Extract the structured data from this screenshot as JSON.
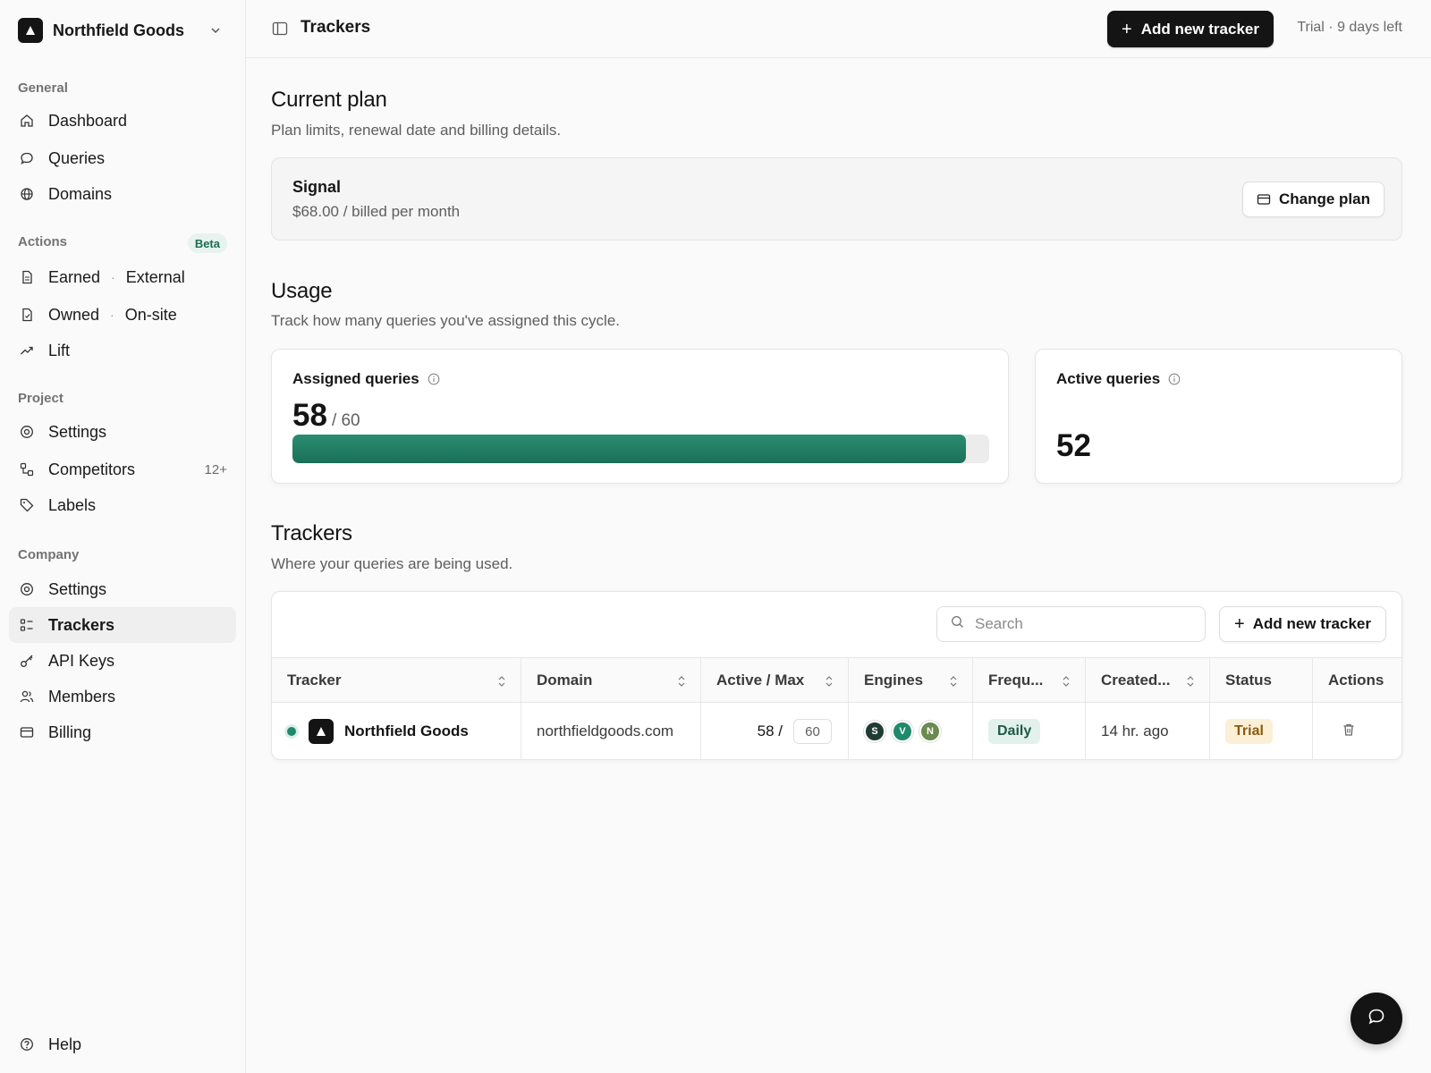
{
  "org": {
    "name": "Northfield Goods"
  },
  "sidebar": {
    "general_title": "General",
    "general": [
      {
        "label": "Dashboard",
        "icon": "home-icon"
      },
      {
        "label": "Queries",
        "icon": "chat-icon"
      },
      {
        "label": "Domains",
        "icon": "globe-icon"
      }
    ],
    "actions_title": "Actions",
    "actions_badge": "Beta",
    "actions": [
      {
        "label": "Earned",
        "suffix": "External",
        "icon": "document-icon"
      },
      {
        "label": "Owned",
        "suffix": "On-site",
        "icon": "document-check-icon"
      },
      {
        "label": "Lift",
        "icon": "trend-up-icon"
      }
    ],
    "project_title": "Project",
    "project": [
      {
        "label": "Settings",
        "icon": "settings-icon"
      },
      {
        "label": "Competitors",
        "count": "12+",
        "icon": "competitors-icon"
      },
      {
        "label": "Labels",
        "icon": "tag-icon"
      }
    ],
    "company_title": "Company",
    "company": [
      {
        "label": "Settings",
        "icon": "settings-icon"
      },
      {
        "label": "Trackers",
        "icon": "list-icon",
        "active": true
      },
      {
        "label": "API Keys",
        "icon": "key-icon"
      },
      {
        "label": "Members",
        "icon": "users-icon"
      },
      {
        "label": "Billing",
        "icon": "card-icon"
      }
    ],
    "help": "Help"
  },
  "topbar": {
    "title": "Trackers",
    "add_button": "Add new tracker",
    "trial": "Trial · 9 days left"
  },
  "plan": {
    "heading": "Current plan",
    "description": "Plan limits, renewal date and billing details.",
    "name": "Signal",
    "price": "$68.00 / billed per month",
    "change_button": "Change plan"
  },
  "usage": {
    "heading": "Usage",
    "description": "Track how many queries you've assigned this cycle.",
    "assigned_title": "Assigned queries",
    "assigned_value": "58",
    "assigned_max": "/ 60",
    "assigned_fraction": 0.967,
    "active_title": "Active queries",
    "active_value": "52"
  },
  "trackers": {
    "heading": "Trackers",
    "description": "Where your queries are being used.",
    "search_placeholder": "Search",
    "add_button": "Add new tracker",
    "columns": [
      "Tracker",
      "Domain",
      "Active / Max",
      "Engines",
      "Frequ...",
      "Created...",
      "Status",
      "Actions"
    ],
    "rows": [
      {
        "name": "Northfield Goods",
        "domain": "northfieldgoods.com",
        "active": "58 /",
        "max": "60",
        "engines": [
          {
            "letter": "S",
            "color": "#1f3b33"
          },
          {
            "letter": "V",
            "color": "#1f8a6a"
          },
          {
            "letter": "N",
            "color": "#6b8a4e"
          }
        ],
        "frequency": "Daily",
        "created": "14 hr. ago",
        "status": "Trial"
      }
    ]
  },
  "colors": {
    "accent": "#1f8a6a",
    "dark": "#141414"
  }
}
